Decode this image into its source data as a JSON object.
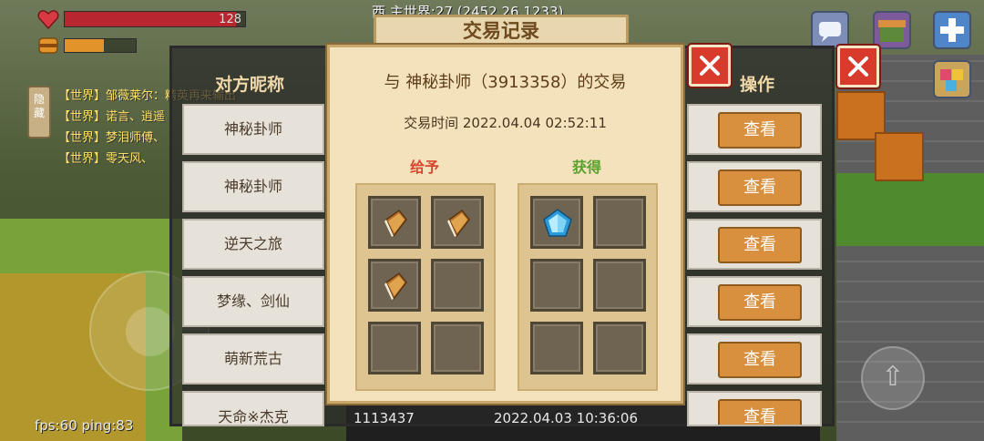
{
  "hud": {
    "hp_value": "128",
    "hp_fraction": 0.95,
    "food_fraction": 0.55,
    "coords": "西 主世界:27 (2452 26 1233)",
    "fps": "fps:60 ping:83",
    "hide_label": "隐藏"
  },
  "chat": {
    "lines": [
      "【世界】邹薇莱尔：精英再来输出",
      "【世界】诺言、逍遥",
      "【世界】梦泪师傅、",
      "【世界】零天风、"
    ]
  },
  "record_window": {
    "title": "交易记录",
    "col_name": "对方昵称",
    "col_op": "操作",
    "rows": [
      {
        "name": "神秘卦师",
        "action": "查看"
      },
      {
        "name": "神秘卦师",
        "action": "查看"
      },
      {
        "name": "逆天之旅",
        "action": "查看"
      },
      {
        "name": "梦缘、剑仙",
        "action": "查看"
      },
      {
        "name": "萌新荒古",
        "action": "查看"
      },
      {
        "name": "天命※杰克",
        "id": "1113437",
        "time": "2022.04.03 10:36:06",
        "action": "查看"
      }
    ]
  },
  "detail": {
    "title": "与 神秘卦师（3913358）的交易",
    "time": "交易时间 2022.04.04 02:52:11",
    "give_label": "给予",
    "get_label": "获得",
    "give_slots": [
      "book-icon",
      "book-icon",
      "book-icon",
      "",
      "",
      ""
    ],
    "get_slots": [
      "diamond-icon",
      "",
      "",
      "",
      "",
      ""
    ]
  },
  "colors": {
    "accent_red": "#d83a2c",
    "button_orange": "#d9903e",
    "give_red": "#d9452f",
    "get_green": "#5aa02c"
  }
}
